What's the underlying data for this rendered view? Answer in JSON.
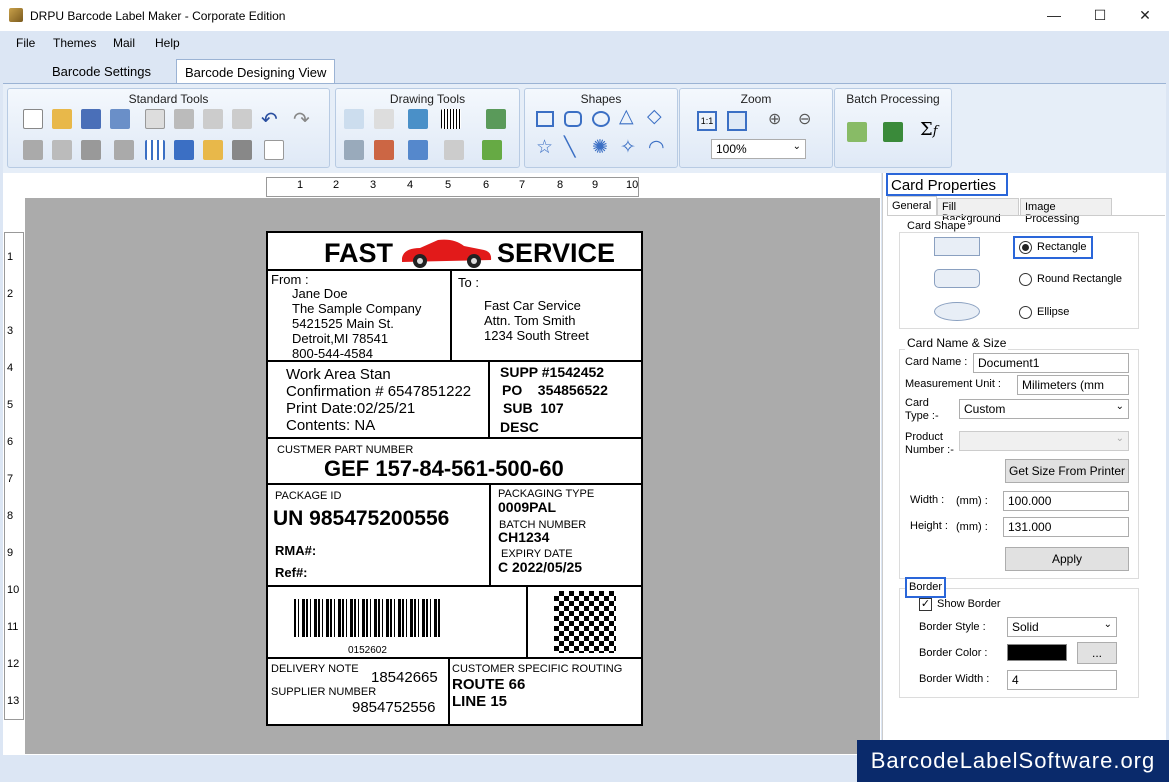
{
  "window": {
    "title": "DRPU Barcode Label Maker - Corporate Edition",
    "minimize": "—",
    "maximize": "☐",
    "close": "✕"
  },
  "menu": [
    "File",
    "Themes",
    "Mail",
    "Help"
  ],
  "tabs": [
    "Barcode Settings",
    "Barcode Designing View"
  ],
  "ribbon": {
    "groups": [
      "Standard Tools",
      "Drawing Tools",
      "Shapes",
      "Zoom",
      "Batch Processing"
    ],
    "zoom_value": "100%",
    "zoom_fit": "1:1"
  },
  "ruler": {
    "h": [
      "1",
      "2",
      "3",
      "4",
      "5",
      "6",
      "7",
      "8",
      "9",
      "10"
    ],
    "v": [
      "1",
      "2",
      "3",
      "4",
      "5",
      "6",
      "7",
      "8",
      "9",
      "10",
      "11",
      "12",
      "13"
    ]
  },
  "card": {
    "header_left": "FAST",
    "header_right": "SERVICE",
    "from_label": "From :",
    "from_lines": [
      "Jane Doe",
      "The Sample Company",
      "5421525 Main St.",
      "Detroit,MI 78541",
      "800-544-4584"
    ],
    "to_label": "To :",
    "to_lines": [
      "Fast Car Service",
      "Attn. Tom Smith",
      "1234 South Street"
    ],
    "work_lines": [
      "Work Area Stan",
      "Confirmation # 6547851222",
      "Print Date:02/25/21",
      "Contents: NA"
    ],
    "supp_lines": [
      "SUPP #1542452",
      "PO    354856522",
      "SUB  107",
      "DESC"
    ],
    "part_label": "CUSTMER PART NUMBER",
    "part_value": "GEF 157-84-561-500-60",
    "package_label": "PACKAGE ID",
    "package_value": "UN 985475200556",
    "rma": "RMA#:",
    "ref": "Ref#:",
    "pack_type_label": "PACKAGING TYPE",
    "pack_type_value": "0009PAL",
    "batch_label": "BATCH NUMBER",
    "batch_value": "CH1234",
    "expiry_label": "EXPIRY DATE",
    "expiry_value": "C 2022/05/25",
    "barcode_text": "0152602",
    "delivery_label": "DELIVERY NOTE",
    "delivery_value": "18542665",
    "supplier_label": "SUPPLIER  NUMBER",
    "supplier_value": "9854752556",
    "routing_label": "CUSTOMER SPECIFIC ROUTING",
    "routing_lines": [
      "ROUTE 66",
      "LINE 15"
    ]
  },
  "props": {
    "title": "Card Properties",
    "tabs": [
      "General",
      "Fill Background",
      "Image Processing"
    ],
    "shape_label": "Card Shape",
    "shapes": [
      "Rectangle",
      "Round Rectangle",
      "Ellipse"
    ],
    "selected_shape": "Rectangle",
    "namesize_label": "Card  Name & Size",
    "card_name_label": "Card Name :",
    "card_name": "Document1",
    "unit_label": "Measurement Unit :",
    "unit_value": "Milimeters (mm",
    "type_label_1": "Card",
    "type_label_2": "Type :-",
    "type_value": "Custom",
    "product_label_1": "Product",
    "product_label_2": "Number :-",
    "get_size": "Get Size From Printer",
    "width_label": "Width :",
    "width_unit": "(mm) :",
    "width_value": "100.000",
    "height_label": "Height :",
    "height_unit": "(mm) :",
    "height_value": "131.000",
    "apply": "Apply",
    "border_label": "Border",
    "show_border": "Show Border",
    "border_style_label": "Border Style :",
    "border_style": "Solid",
    "border_color_label": "Border Color :",
    "border_color": "#000000",
    "browse": "...",
    "border_width_label": "Border Width :",
    "border_width": "4"
  },
  "brand": "BarcodeLabelSoftware.org",
  "colors": {
    "accent": "#2a66d9",
    "car": "#e21a1a",
    "brand_bg": "#0a2a6b"
  }
}
